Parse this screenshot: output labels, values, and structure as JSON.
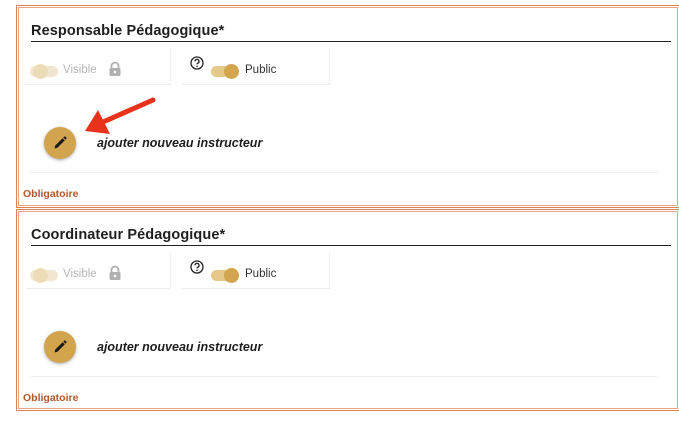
{
  "sections": [
    {
      "title": "Responsable Pédagogique*",
      "visibility": {
        "label": "Visible",
        "enabled": false,
        "icon": "lock-icon"
      },
      "access": {
        "label": "Public",
        "enabled": true,
        "help_icon": "help-circle-icon"
      },
      "instructor_action": {
        "label": "ajouter nouveau instructeur",
        "icon": "pencil-icon"
      },
      "required_text": "Obligatoire"
    },
    {
      "title": "Coordinateur Pédagogique*",
      "visibility": {
        "label": "Visible",
        "enabled": false,
        "icon": "lock-icon"
      },
      "access": {
        "label": "Public",
        "enabled": true,
        "help_icon": "help-circle-icon"
      },
      "instructor_action": {
        "label": "ajouter nouveau instructeur",
        "icon": "pencil-icon"
      },
      "required_text": "Obligatoire"
    }
  ],
  "colors": {
    "accent": "#d2a54f",
    "section_border": "#e8a48d",
    "required_text": "#b5562a",
    "annotation_arrow": "#e8321c"
  }
}
